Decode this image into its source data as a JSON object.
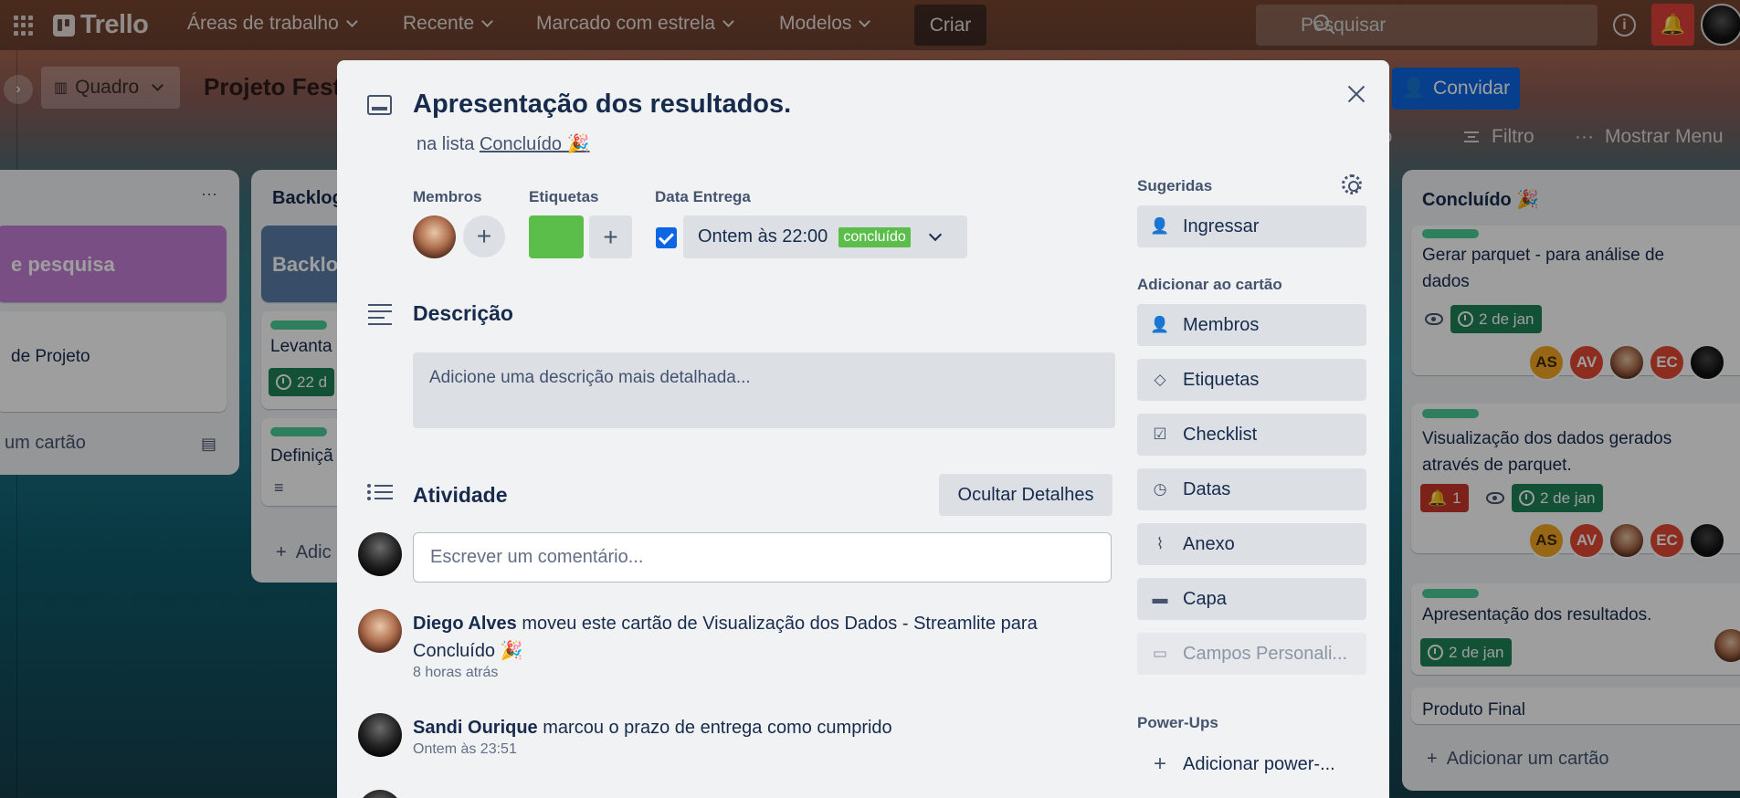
{
  "topnav": {
    "logo": "Trello",
    "items": [
      "Áreas de trabalho",
      "Recente",
      "Marcado com estrela",
      "Modelos"
    ],
    "create": "Criar",
    "search_placeholder": "Pesquisar"
  },
  "board": {
    "view": "Quadro",
    "title": "Projeto Fest",
    "invite": "Convidar",
    "header_partial": "io",
    "filter": "Filtro",
    "menu": "Mostrar Menu"
  },
  "lists": {
    "left": {
      "card_heading": "e pesquisa",
      "card_text": "de Projeto",
      "add_card": "um cartão"
    },
    "backlog": {
      "title": "Backlog",
      "cover_text": "Backlo",
      "card1_text": "Levanta",
      "card1_date": "22 d",
      "card2_text": "Definiçã",
      "add_card": "Adic"
    },
    "concluido": {
      "title": "Concluído 🎉",
      "cards": [
        {
          "text": "Gerar parquet - para análise de dados",
          "date": "2 de jan",
          "members": [
            "AS",
            "AV",
            "",
            "EC",
            ""
          ]
        },
        {
          "text": "Visualização dos dados gerados através de parquet.",
          "notif": "1",
          "date": "2 de jan",
          "members": [
            "AS",
            "AV",
            "",
            "EC",
            ""
          ]
        },
        {
          "text": "Apresentação dos resultados.",
          "date": "2 de jan"
        },
        {
          "text": "Produto Final"
        }
      ],
      "add_card": "Adicionar um cartão"
    }
  },
  "modal": {
    "title": "Apresentação dos resultados.",
    "in_list_prefix": "na lista",
    "list_name": "Concluído 🎉",
    "members_label": "Membros",
    "labels_label": "Etiquetas",
    "due_label": "Data Entrega",
    "due_value": "Ontem às 22:00",
    "due_status": "concluído",
    "description_title": "Descrição",
    "description_placeholder": "Adicione uma descrição mais detalhada...",
    "activity_title": "Atividade",
    "hide_details": "Ocultar Detalhes",
    "comment_placeholder": "Escrever um comentário...",
    "activity": [
      {
        "user": "Diego Alves",
        "text": "moveu este cartão de Visualização dos Dados - Streamlite para Concluído 🎉",
        "time": "8 horas atrás"
      },
      {
        "user": "Sandi Ourique",
        "text": "marcou o prazo de entrega como cumprido",
        "time": "Ontem às 23:51"
      }
    ],
    "sidebar": {
      "suggested_label": "Sugeridas",
      "join": "Ingressar",
      "add_to_card_label": "Adicionar ao cartão",
      "buttons": [
        "Membros",
        "Etiquetas",
        "Checklist",
        "Datas",
        "Anexo",
        "Capa",
        "Campos Personali..."
      ],
      "powerups_label": "Power-Ups",
      "add_powerup": "Adicionar power-..."
    }
  }
}
